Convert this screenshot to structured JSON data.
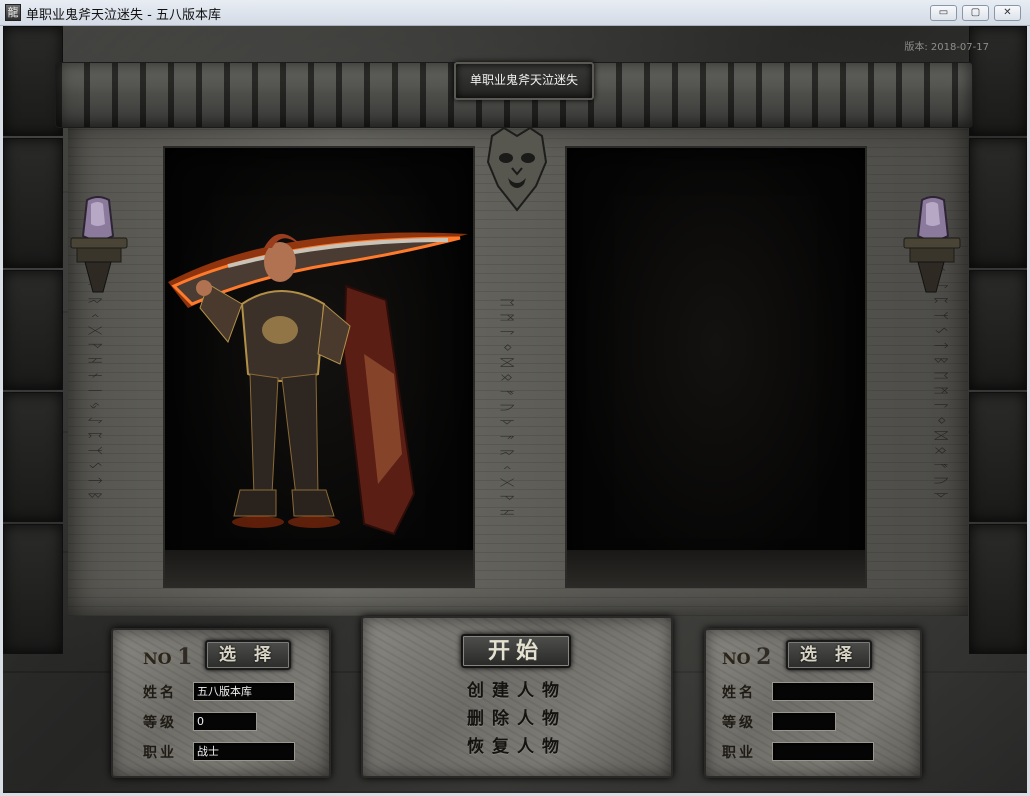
{
  "window": {
    "icon": "龍",
    "title": "单职业鬼斧天泣迷失 - 五八版本库",
    "buttons": {
      "minimize": "▭",
      "maximize": "▢",
      "close": "✕"
    }
  },
  "game": {
    "version": "版本: 2018-07-17",
    "server_title": "单职业鬼斧天泣迷失"
  },
  "slot1": {
    "no_text": "NO",
    "no_number": "1",
    "select_label": "选 择",
    "name_label": "姓名",
    "name_value": "五八版本库",
    "level_label": "等级",
    "level_value": "0",
    "job_label": "职业",
    "job_value": "战士"
  },
  "slot2": {
    "no_text": "NO",
    "no_number": "2",
    "select_label": "选 择",
    "name_label": "姓名",
    "name_value": "",
    "level_label": "等级",
    "level_value": "",
    "job_label": "职业",
    "job_value": ""
  },
  "center": {
    "start_label": "开始",
    "create_label": "创建人物",
    "delete_label": "删除人物",
    "restore_label": "恢复人物"
  },
  "icons": {
    "app": "app-icon",
    "gargoyle": "gargoyle-carving",
    "lamp": "crystal-lamp"
  }
}
